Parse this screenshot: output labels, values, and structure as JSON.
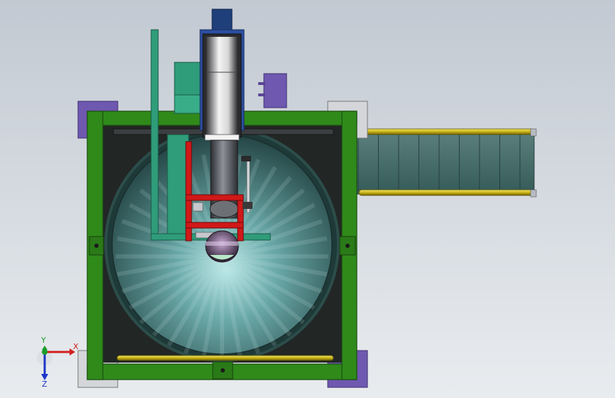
{
  "view": {
    "background_top": "#c2c9d2",
    "background_bottom": "#e9ecef"
  },
  "triad": {
    "x_label": "X",
    "y_label": "Y",
    "z_label": "Z",
    "x_color": "#d21f1f",
    "y_color": "#1c9b2a",
    "z_color": "#1d35c8"
  },
  "colors": {
    "frame_green": "#2f8a1a",
    "frame_dark": "#1f2a1f",
    "cone_dark": "#244646",
    "cone_light": "#9fd4d4",
    "tank_rim": "#2c4d4a",
    "red_frame": "#d11818",
    "teal_panel": "#2f9c7a",
    "motor_blue": "#2c4ea0",
    "purple_block": "#6f58b0",
    "yellow_rail": "#d8c21c",
    "conveyor": "#3f6a68",
    "plate_grey": "#c9cbd0"
  }
}
